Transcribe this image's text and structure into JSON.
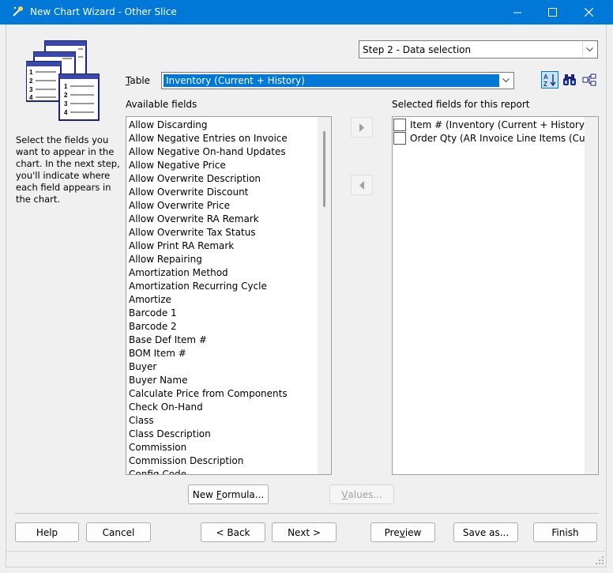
{
  "window": {
    "title": "New Chart Wizard - Other Slice"
  },
  "step": {
    "value": "Step 2 - Data selection"
  },
  "instructions": {
    "lines": [
      "Select the fields you",
      "want to appear in the",
      "chart. In the next step,",
      "you'll indicate where",
      "each field appears in",
      "the chart."
    ]
  },
  "table": {
    "label_underlined": "T",
    "label_rest": "able",
    "value": "Inventory (Current + History)"
  },
  "toolbar": {
    "sort_icon": "sort-az-icon",
    "find_icon": "binoculars-icon",
    "relations_icon": "hierarchy-icon"
  },
  "available": {
    "label": "Available fields",
    "items": [
      "Allow Discarding",
      "Allow Negative Entries on Invoice",
      "Allow Negative On-hand Updates",
      "Allow Negative Price",
      "Allow Overwrite Description",
      "Allow Overwrite Discount",
      "Allow Overwrite Price",
      "Allow Overwrite RA Remark",
      "Allow Overwrite Tax Status",
      "Allow Print RA Remark",
      "Allow Repairing",
      "Amortization Method",
      "Amortization Recurring Cycle",
      "Amortize",
      "Barcode 1",
      "Barcode 2",
      "Base Def Item #",
      "BOM Item #",
      "Buyer",
      "Buyer Name",
      "Calculate Price from Components",
      "Check On-Hand",
      "Class",
      "Class Description",
      "Commission",
      "Commission Description",
      "Config Code"
    ]
  },
  "selected": {
    "label": "Selected fields for this report",
    "items": [
      "Item # (Inventory (Current + History))",
      "Order Qty (AR Invoice Line Items (Current"
    ]
  },
  "buttons": {
    "new_formula_pre": "New ",
    "new_formula_u": "F",
    "new_formula_post": "ormula...",
    "values_u": "V",
    "values_post": "alues...",
    "help": "Help",
    "cancel": "Cancel",
    "back": "< Back",
    "next": "Next >",
    "preview_pre": "Pre",
    "preview_u": "v",
    "preview_post": "iew",
    "save_as": "Save as...",
    "finish": "Finish"
  },
  "colors": {
    "titlebar": "#0078d7",
    "selection": "#0078d7"
  }
}
